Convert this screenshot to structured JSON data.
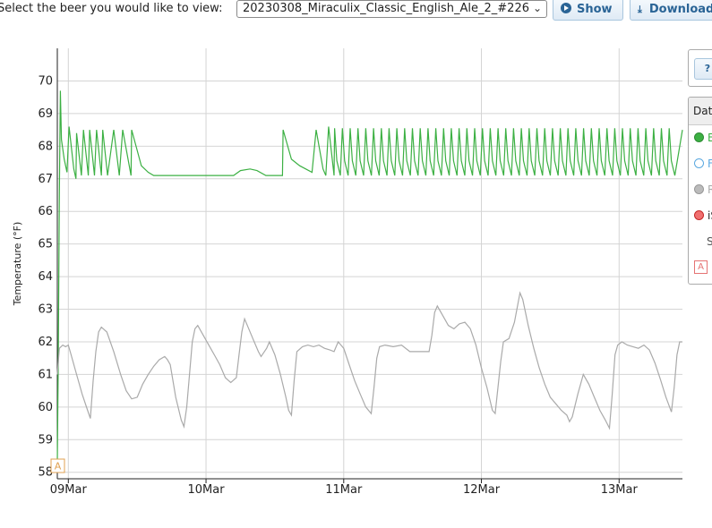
{
  "header": {
    "select_label": "Select the beer you would like to view:",
    "selected_beer": "20230308_Miraculix_Classic_English_Ale_2_#226",
    "show_label": "Show",
    "download_label": "Download"
  },
  "side_panel": {
    "help_label": "?",
    "data_header": "Dat",
    "legend_items": [
      {
        "label": "B",
        "color": "#3cb043",
        "filled": true
      },
      {
        "label": "F",
        "color": "#5aa8e0",
        "filled": false
      },
      {
        "label": "R",
        "color": "#aaaaaa",
        "filled": true
      },
      {
        "label": "iS",
        "color": "#e53935",
        "filled": true
      },
      {
        "label": "S",
        "color": null,
        "filled": false
      }
    ],
    "annotation_marker": "A"
  },
  "chart_data": {
    "type": "line",
    "ylabel": "Temperature (°F)",
    "ylim": [
      57.8,
      71
    ],
    "y_ticks": [
      58,
      59,
      60,
      61,
      62,
      63,
      64,
      65,
      66,
      67,
      68,
      69,
      70
    ],
    "xlim_days": [
      8.92,
      13.46
    ],
    "x_ticks": [
      {
        "label": "09Mar",
        "day": 9
      },
      {
        "label": "10Mar",
        "day": 10
      },
      {
        "label": "11Mar",
        "day": 11
      },
      {
        "label": "12Mar",
        "day": 12
      },
      {
        "label": "13Mar",
        "day": 13
      }
    ],
    "grid": true,
    "annotation_marker": "A",
    "series": [
      {
        "color": "#3cb043",
        "style": "sawtooth",
        "points": [
          [
            8.92,
            58.3
          ],
          [
            8.927,
            61.6
          ],
          [
            8.935,
            66.6
          ],
          [
            8.942,
            69.7
          ],
          [
            8.95,
            68.2
          ],
          [
            8.97,
            67.6
          ],
          [
            8.99,
            67.2
          ],
          [
            9.005,
            68.6
          ],
          [
            9.04,
            67.3
          ],
          [
            9.055,
            67.0
          ],
          [
            9.06,
            68.4
          ],
          [
            9.095,
            67.1
          ],
          [
            9.11,
            68.5
          ],
          [
            9.145,
            67.1
          ],
          [
            9.155,
            68.5
          ],
          [
            9.19,
            67.1
          ],
          [
            9.205,
            68.5
          ],
          [
            9.24,
            67.1
          ],
          [
            9.25,
            68.5
          ],
          [
            9.285,
            67.1
          ],
          [
            9.33,
            68.5
          ],
          [
            9.37,
            67.1
          ],
          [
            9.395,
            68.5
          ],
          [
            9.455,
            67.1
          ],
          [
            9.46,
            68.5
          ],
          [
            9.53,
            67.4
          ],
          [
            9.58,
            67.2
          ],
          [
            9.62,
            67.1
          ],
          [
            10.0,
            67.1
          ],
          [
            10.2,
            67.1
          ],
          [
            10.25,
            67.25
          ],
          [
            10.32,
            67.3
          ],
          [
            10.37,
            67.25
          ],
          [
            10.435,
            67.1
          ],
          [
            10.555,
            67.1
          ],
          [
            10.56,
            68.5
          ],
          [
            10.62,
            67.6
          ],
          [
            10.68,
            67.4
          ],
          [
            10.77,
            67.2
          ],
          [
            10.8,
            68.5
          ],
          [
            10.85,
            67.3
          ],
          [
            10.87,
            67.1
          ],
          [
            10.89,
            68.6
          ],
          [
            10.93,
            67.1
          ]
        ]
      },
      {
        "color": "#aaaaaa",
        "style": "profile",
        "points": [
          [
            8.92,
            61.0
          ],
          [
            8.935,
            61.8
          ],
          [
            8.96,
            61.9
          ],
          [
            8.98,
            61.85
          ],
          [
            9.0,
            61.9
          ],
          [
            9.02,
            61.6
          ],
          [
            9.06,
            61.0
          ],
          [
            9.1,
            60.4
          ],
          [
            9.14,
            59.9
          ],
          [
            9.16,
            59.65
          ],
          [
            9.18,
            60.8
          ],
          [
            9.2,
            61.7
          ],
          [
            9.22,
            62.3
          ],
          [
            9.24,
            62.45
          ],
          [
            9.28,
            62.3
          ],
          [
            9.33,
            61.7
          ],
          [
            9.38,
            61.0
          ],
          [
            9.42,
            60.5
          ],
          [
            9.46,
            60.25
          ],
          [
            9.5,
            60.3
          ],
          [
            9.54,
            60.7
          ],
          [
            9.58,
            61.0
          ],
          [
            9.62,
            61.25
          ],
          [
            9.66,
            61.45
          ],
          [
            9.7,
            61.55
          ],
          [
            9.72,
            61.45
          ],
          [
            9.74,
            61.3
          ],
          [
            9.78,
            60.3
          ],
          [
            9.82,
            59.6
          ],
          [
            9.84,
            59.4
          ],
          [
            9.86,
            60.0
          ],
          [
            9.88,
            61.0
          ],
          [
            9.9,
            62.0
          ],
          [
            9.92,
            62.4
          ],
          [
            9.94,
            62.5
          ],
          [
            9.98,
            62.2
          ],
          [
            10.02,
            61.9
          ],
          [
            10.06,
            61.6
          ],
          [
            10.1,
            61.3
          ],
          [
            10.14,
            60.9
          ],
          [
            10.18,
            60.75
          ],
          [
            10.22,
            60.9
          ],
          [
            10.24,
            61.6
          ],
          [
            10.26,
            62.3
          ],
          [
            10.28,
            62.7
          ],
          [
            10.3,
            62.5
          ],
          [
            10.34,
            62.1
          ],
          [
            10.38,
            61.7
          ],
          [
            10.4,
            61.55
          ],
          [
            10.44,
            61.8
          ],
          [
            10.46,
            62.0
          ],
          [
            10.5,
            61.6
          ],
          [
            10.54,
            61.0
          ],
          [
            10.58,
            60.3
          ],
          [
            10.6,
            59.9
          ],
          [
            10.62,
            59.75
          ],
          [
            10.64,
            60.8
          ],
          [
            10.66,
            61.7
          ],
          [
            10.7,
            61.85
          ],
          [
            10.74,
            61.9
          ],
          [
            10.78,
            61.85
          ],
          [
            10.82,
            61.9
          ],
          [
            10.86,
            61.8
          ],
          [
            10.9,
            61.75
          ],
          [
            10.93,
            61.7
          ]
        ]
      }
    ]
  }
}
